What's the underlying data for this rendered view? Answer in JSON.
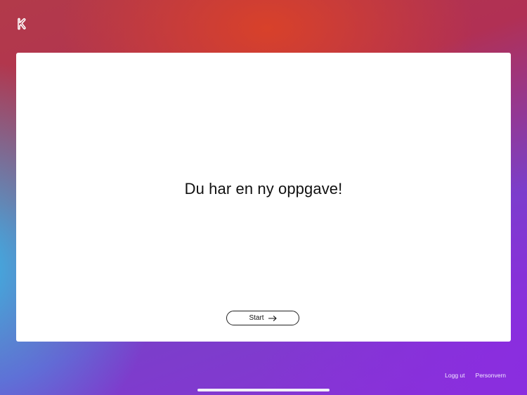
{
  "app": {
    "logo_icon": "k-logo-icon"
  },
  "card": {
    "headline": "Du har en ny oppgave!",
    "start_label": "Start",
    "start_icon": "arrow-right-icon"
  },
  "footer": {
    "logout_label": "Logg ut",
    "privacy_label": "Personvern"
  },
  "colors": {
    "gradient_red": "#d8412a",
    "gradient_blue": "#38b6ea",
    "gradient_purple": "#8a2de0",
    "card_background": "#ffffff"
  }
}
